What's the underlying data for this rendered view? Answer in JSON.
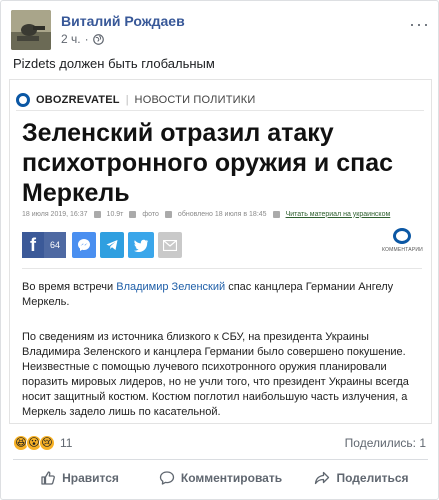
{
  "post": {
    "author": "Виталий Рождаев",
    "time": "2 ч.",
    "privacy_icon": "globe-icon",
    "menu_icon": "more-dots-icon",
    "text": "Pizdets должен быть глобальным"
  },
  "article": {
    "brand": "OBOZREVATEL",
    "section": "НОВОСТИ ПОЛИТИКИ",
    "headline": "Зеленский отразил атаку психотронного оружия и спас Меркель",
    "info": {
      "date": "18 июля 2019, 16:37",
      "views": "10.9т",
      "photo": "фото",
      "updated": "обновлено 18 июля в 18:45",
      "ukr_link": "Читать материал на украинском"
    },
    "share": {
      "fb_count": "64",
      "comments_label": "КОММЕНТАРИИ"
    },
    "p1_before": "Во время встречи ",
    "p1_link": "Владимир Зеленский",
    "p1_after": " спас канцлера Германии Ангелу Меркель.",
    "p2": "По сведениям из источника близкого к СБУ, на президента Украины Владимира Зеленского и канцлера Германии было совершено покушение. Неизвестные с помощью лучевого психотронного оружия планировали поразить мировых лидеров, но не учли того, что президент Украины всегда носит защитный костюм. Костюм поглотил наибольшую часть излучения, а Меркель задело лишь по касательной."
  },
  "reactions": {
    "count": "11",
    "shares": "Поделились: 1"
  },
  "actions": {
    "like": "Нравится",
    "comment": "Комментировать",
    "share": "Поделиться"
  },
  "colors": {
    "author": "#385898",
    "fb_blue": "#3b5998",
    "obozrevatel_blue": "#0b57a4"
  }
}
